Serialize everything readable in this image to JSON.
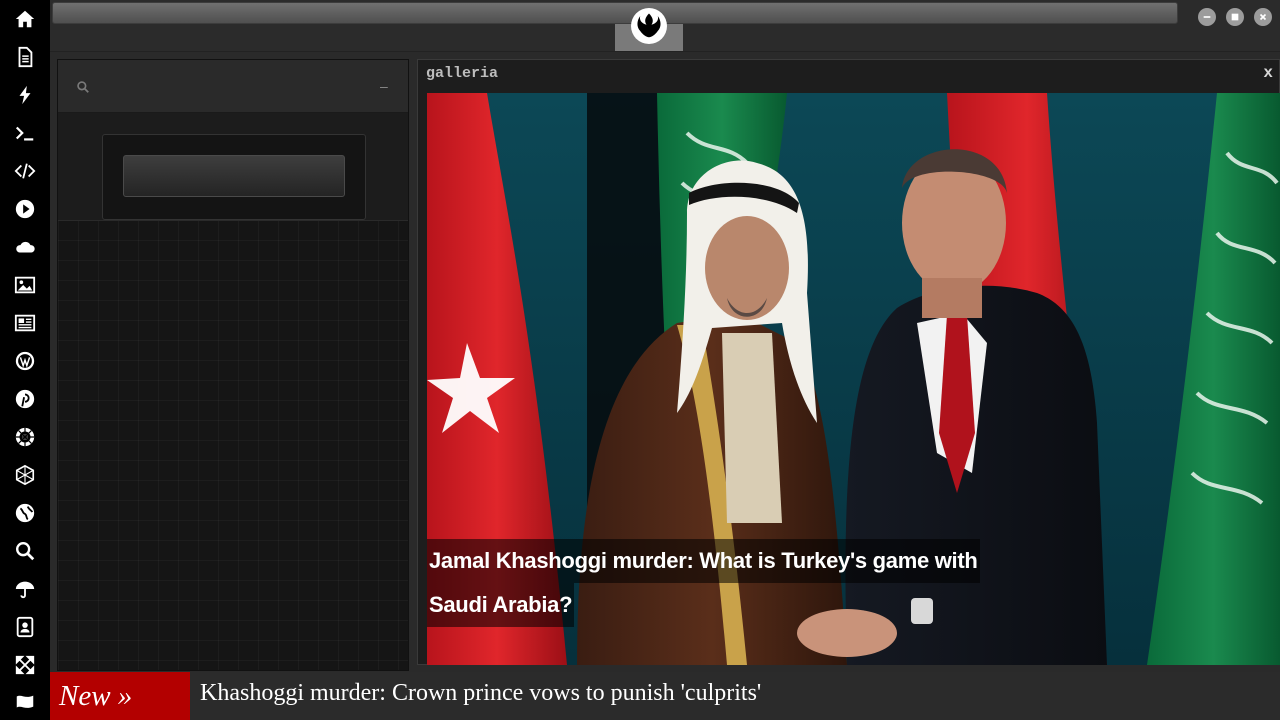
{
  "sidebar": {
    "items": [
      {
        "icon": "home-icon"
      },
      {
        "icon": "document-icon"
      },
      {
        "icon": "bolt-icon"
      },
      {
        "icon": "terminal-icon"
      },
      {
        "icon": "code-icon"
      },
      {
        "icon": "play-icon"
      },
      {
        "icon": "cloud-icon"
      },
      {
        "icon": "image-icon"
      },
      {
        "icon": "newspaper-icon"
      },
      {
        "icon": "wordpress-icon"
      },
      {
        "icon": "pinterest-icon"
      },
      {
        "icon": "galactic-empire-icon"
      },
      {
        "icon": "network-icon"
      },
      {
        "icon": "globe-icon"
      },
      {
        "icon": "search-icon"
      },
      {
        "icon": "umbrella-icon"
      },
      {
        "icon": "contact-book-icon"
      },
      {
        "icon": "expand-icon"
      },
      {
        "icon": "flag-icon"
      }
    ]
  },
  "topbar": {
    "logo_icon": "rebel-alliance-icon"
  },
  "left_panel": {
    "minimize_label": "–",
    "input_value": ""
  },
  "gallery": {
    "title": "galleria",
    "close_label": "x",
    "caption_line1": " Jamal Khashoggi murder: What is Turkey's game with",
    "caption_line2": "Saudi Arabia?"
  },
  "ticker": {
    "badge": "New »",
    "headline": "Khashoggi murder: Crown prince vows to punish 'culprits'"
  },
  "colors": {
    "ticker_badge": "#b30000",
    "desktop": "#2a2a2a"
  }
}
